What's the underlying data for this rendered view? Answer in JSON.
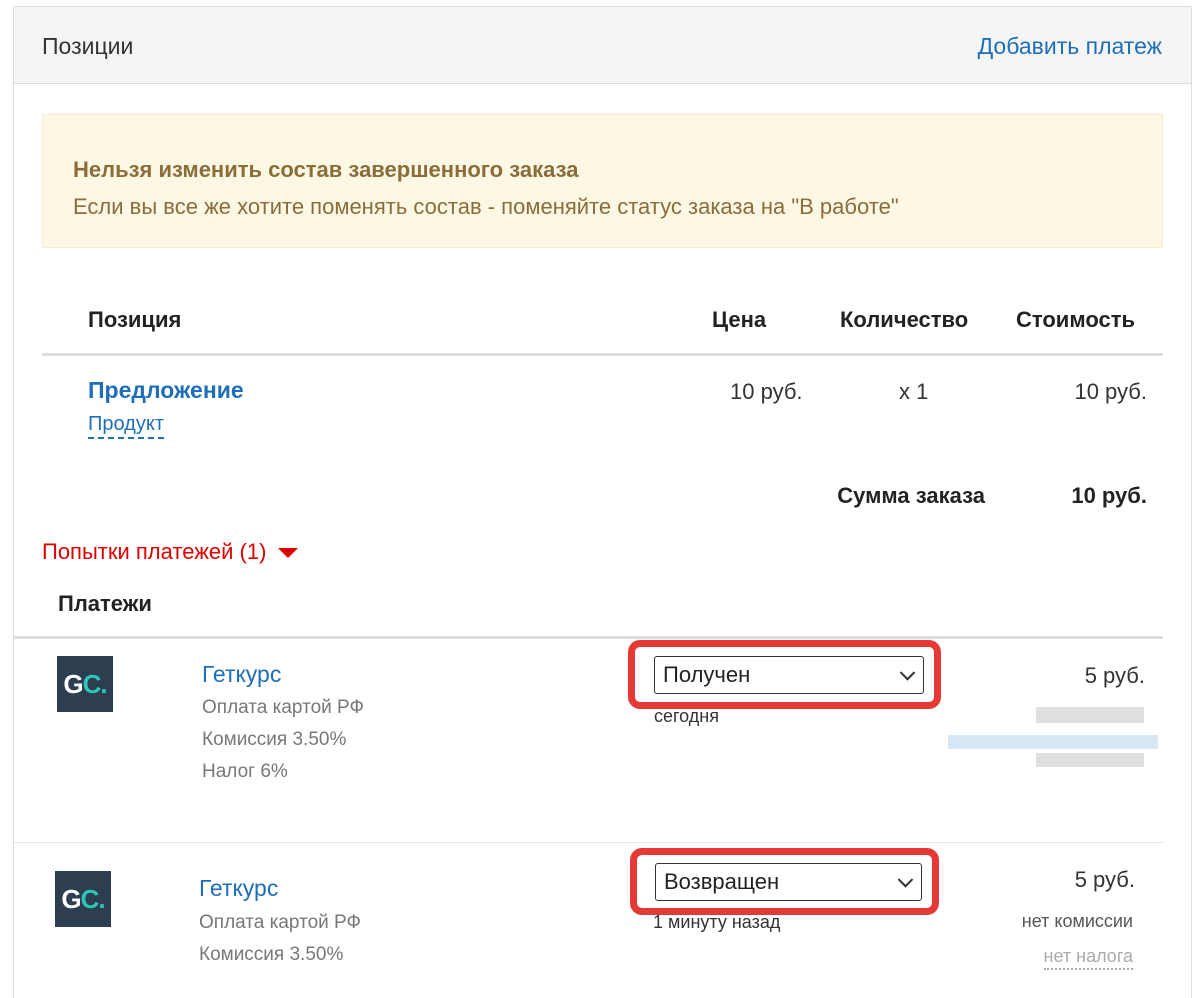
{
  "header": {
    "title": "Позиции",
    "add_payment": "Добавить платеж"
  },
  "alert": {
    "title": "Нельзя изменить состав завершенного заказа",
    "text": "Если вы все же хотите поменять состав - поменяйте статус заказа на \"В работе\""
  },
  "table": {
    "headers": {
      "position": "Позиция",
      "price": "Цена",
      "quantity": "Количество",
      "cost": "Стоимость"
    },
    "row": {
      "offer": "Предложение",
      "product": "Продукт",
      "price": "10 руб.",
      "quantity": "x 1",
      "cost": "10 руб."
    },
    "total_label": "Сумма заказа",
    "total_value": "10 руб."
  },
  "attempts_label": "Попытки платежей (1)",
  "payments_title": "Платежи",
  "payments": [
    {
      "logo": {
        "g": "G",
        "c": "C."
      },
      "name": "Геткурс",
      "method": "Оплата картой РФ",
      "commission": "Комиссия 3.50%",
      "tax": "Налог 6%",
      "status": "Получен",
      "time": "сегодня",
      "amount": "5  руб."
    },
    {
      "logo": {
        "g": "G",
        "c": "C."
      },
      "name": "Геткурс",
      "method": "Оплата картой РФ",
      "commission": "Комиссия 3.50%",
      "status": "Возвращен",
      "time": "1 минуту назад",
      "amount": "5  руб.",
      "no_commission": "нет комиссии",
      "no_tax": "нет налога"
    }
  ],
  "colors": {
    "link": "#1e6fb8",
    "alert_bg": "#fcf8e3",
    "alert_text": "#8a6d3b",
    "highlight": "#e53935",
    "attempts": "#e00000"
  }
}
